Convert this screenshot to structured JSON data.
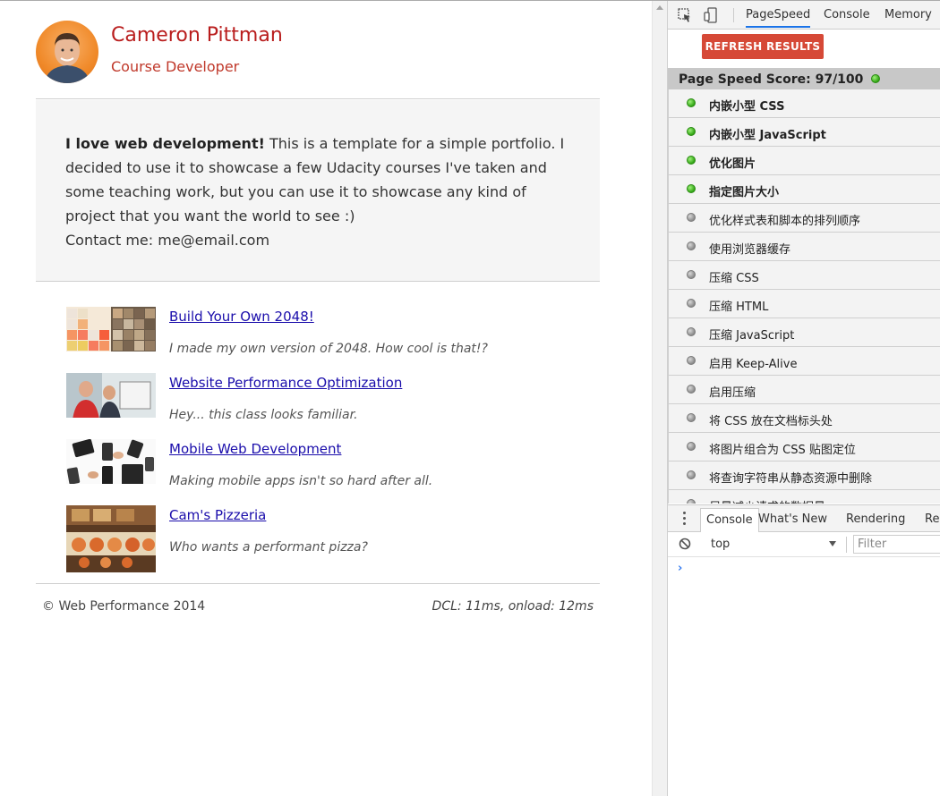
{
  "page": {
    "name": "Cameron Pittman",
    "role": "Course Developer",
    "intro_bold": "I love web development!",
    "intro_rest": " This is a template for a simple portfolio. I decided to use it to showcase a few Udacity courses I've taken and some teaching work, but you can use it to showcase any kind of project that you want the world to see :)",
    "contact": "Contact me: me@email.com",
    "projects": [
      {
        "title": "Build Your Own 2048!",
        "desc": "I made my own version of 2048. How cool is that!?"
      },
      {
        "title": "Website Performance Optimization",
        "desc": "Hey... this class looks familiar."
      },
      {
        "title": "Mobile Web Development",
        "desc": "Making mobile apps isn't so hard after all."
      },
      {
        "title": "Cam's Pizzeria",
        "desc": "Who wants a performant pizza?"
      }
    ],
    "footer_copy": "© Web Performance 2014",
    "footer_perf": "DCL: 11ms, onload: 12ms"
  },
  "devtools": {
    "tabs": [
      "PageSpeed",
      "Console",
      "Memory"
    ],
    "active_tab": "PageSpeed",
    "refresh_label": "REFRESH RESULTS",
    "score_text": "Page Speed Score: 97/100",
    "rules": [
      {
        "label": "内嵌小型 CSS",
        "status": "green",
        "strong": true
      },
      {
        "label": "内嵌小型 JavaScript",
        "status": "green",
        "strong": true
      },
      {
        "label": "优化图片",
        "status": "green",
        "strong": true
      },
      {
        "label": "指定图片大小",
        "status": "green",
        "strong": true
      },
      {
        "label": "优化样式表和脚本的排列顺序",
        "status": "gray",
        "strong": false
      },
      {
        "label": "使用浏览器缓存",
        "status": "gray",
        "strong": false
      },
      {
        "label": "压缩 CSS",
        "status": "gray",
        "strong": false
      },
      {
        "label": "压缩 HTML",
        "status": "gray",
        "strong": false
      },
      {
        "label": "压缩 JavaScript",
        "status": "gray",
        "strong": false
      },
      {
        "label": "启用 Keep-Alive",
        "status": "gray",
        "strong": false
      },
      {
        "label": "启用压缩",
        "status": "gray",
        "strong": false
      },
      {
        "label": "将 CSS 放在文档标头处",
        "status": "gray",
        "strong": false
      },
      {
        "label": "将图片组合为 CSS 贴图定位",
        "status": "gray",
        "strong": false
      },
      {
        "label": "将查询字符串从静态资源中删除",
        "status": "gray",
        "strong": false
      },
      {
        "label": "尽量减少请求的数据量",
        "status": "gray",
        "strong": false
      }
    ],
    "drawer_tabs": [
      "Console",
      "What's New",
      "Rendering",
      "Rer"
    ],
    "context": "top",
    "filter_placeholder": "Filter",
    "prompt": "›"
  }
}
